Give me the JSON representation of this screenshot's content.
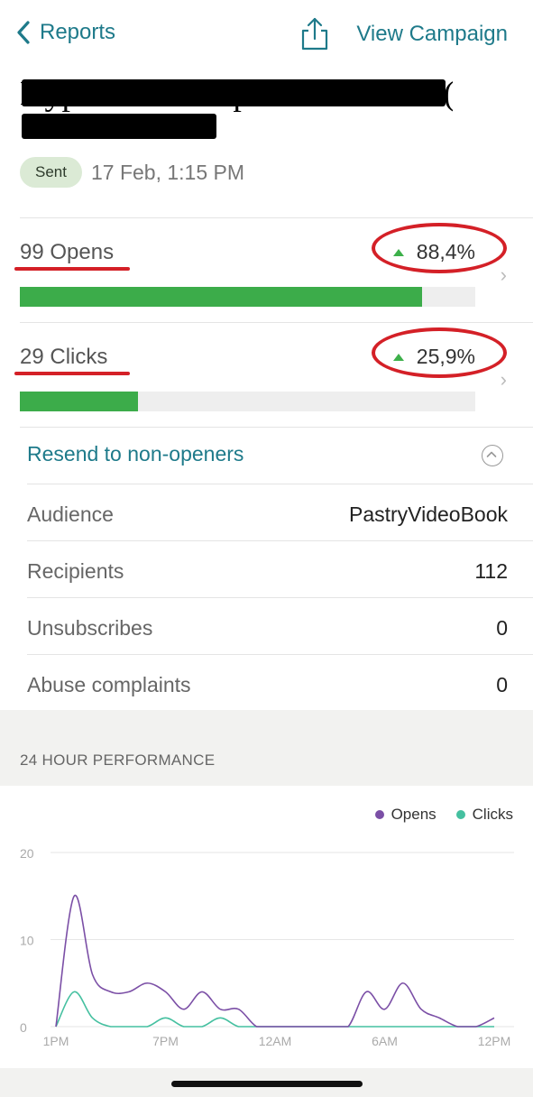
{
  "nav": {
    "back_label": "Reports",
    "view_campaign_label": "View Campaign"
  },
  "campaign": {
    "title": "Hyper Domain pastel sweet to (Solo Classe)",
    "status": "Sent",
    "sent_date": "17 Feb, 1:15 PM"
  },
  "metrics": [
    {
      "label": "99 Opens",
      "percent": "88,4%",
      "rate": 0.884
    },
    {
      "label": "29 Clicks",
      "percent": "25,9%",
      "rate": 0.259
    }
  ],
  "resend_label": "Resend to non-openers",
  "details": [
    {
      "label": "Audience",
      "value": "PastryVideoBook"
    },
    {
      "label": "Recipients",
      "value": "112"
    },
    {
      "label": "Unsubscribes",
      "value": "0"
    },
    {
      "label": "Abuse complaints",
      "value": "0"
    }
  ],
  "performance": {
    "title": "24 HOUR PERFORMANCE"
  },
  "colors": {
    "accent": "#1e7a8a",
    "opens": "#7b4fa6",
    "clicks": "#45c0a0",
    "bar": "#3cac4a",
    "annotation": "#d42027"
  },
  "chart_data": {
    "type": "line",
    "x": [
      0,
      1,
      2,
      3,
      4,
      5,
      6,
      7,
      8,
      9,
      10,
      11,
      12,
      13,
      14,
      15,
      16,
      17,
      18,
      19,
      20,
      21,
      22,
      23,
      24
    ],
    "xticks": [
      "1PM",
      "7PM",
      "12AM",
      "6AM",
      "12PM"
    ],
    "ylim": [
      0,
      20
    ],
    "yticks": [
      0,
      10,
      20
    ],
    "grid": true,
    "legend": "top-right",
    "series": [
      {
        "name": "Opens",
        "color": "#7b4fa6",
        "values": [
          0,
          15,
          6,
          4,
          4,
          5,
          4,
          2,
          4,
          2,
          2,
          0,
          0,
          0,
          0,
          0,
          0,
          4,
          2,
          5,
          2,
          1,
          0,
          0,
          1
        ]
      },
      {
        "name": "Clicks",
        "color": "#45c0a0",
        "values": [
          0,
          4,
          1,
          0,
          0,
          0,
          1,
          0,
          0,
          1,
          0,
          0,
          0,
          0,
          0,
          0,
          0,
          0,
          0,
          0,
          0,
          0,
          0,
          0,
          0
        ]
      }
    ]
  }
}
